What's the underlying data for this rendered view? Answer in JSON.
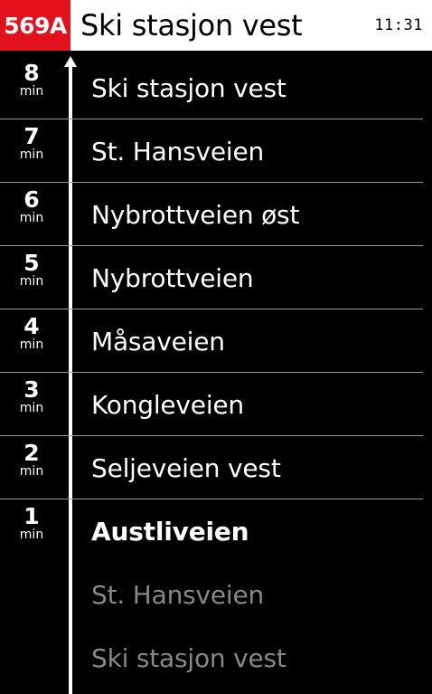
{
  "header": {
    "route": "569A",
    "destination": "Ski stasjon vest",
    "time": "11:31",
    "route_color": "#e1121b"
  },
  "minute_unit": "min",
  "upcoming_stops": [
    {
      "minutes": "8",
      "name": "Ski stasjon vest"
    },
    {
      "minutes": "7",
      "name": "St. Hansveien"
    },
    {
      "minutes": "6",
      "name": "Nybrottveien øst"
    },
    {
      "minutes": "5",
      "name": "Nybrottveien"
    },
    {
      "minutes": "4",
      "name": "Måsaveien"
    },
    {
      "minutes": "3",
      "name": "Kongleveien"
    },
    {
      "minutes": "2",
      "name": "Seljeveien vest"
    },
    {
      "minutes": "1",
      "name": "Austliveien"
    }
  ],
  "current_stop_index": 7,
  "passed_stops": [
    {
      "name": "St. Hansveien"
    },
    {
      "name": "Ski stasjon vest"
    }
  ]
}
